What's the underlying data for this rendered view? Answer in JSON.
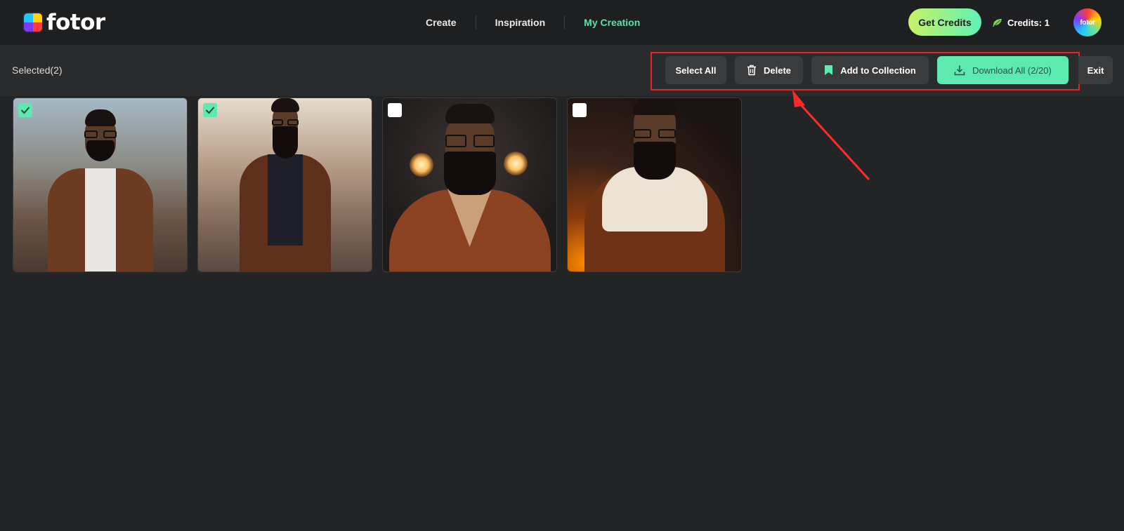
{
  "app": {
    "logo_text": "fotor",
    "avatar_text": "fotor"
  },
  "nav": {
    "items": [
      {
        "label": "Create",
        "active": false
      },
      {
        "label": "Inspiration",
        "active": false
      },
      {
        "label": "My Creation",
        "active": true
      }
    ]
  },
  "header": {
    "get_credits_label": "Get Credits",
    "credits_label": "Credits: 1"
  },
  "toolbar": {
    "selected_label": "Selected(2)",
    "select_all_label": "Select All",
    "delete_label": "Delete",
    "add_collection_label": "Add to Collection",
    "download_all_label": "Download All (2/20)",
    "exit_label": "Exit"
  },
  "gallery": {
    "images": [
      {
        "selected": true
      },
      {
        "selected": true
      },
      {
        "selected": false
      },
      {
        "selected": false
      }
    ]
  },
  "colors": {
    "accent": "#5ee9b1",
    "nav_active": "#5ee0a9",
    "highlight_border": "#e52524",
    "arrow": "#ff2a2a",
    "background": "#232425"
  },
  "icons": {
    "delete": "trash-icon",
    "collection": "bookmark-icon",
    "download": "download-icon",
    "credits": "leaf-icon",
    "checked": "check-icon"
  }
}
